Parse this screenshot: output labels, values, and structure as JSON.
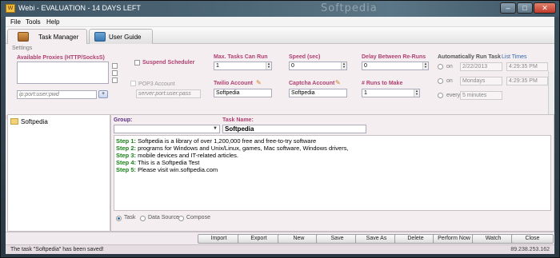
{
  "window": {
    "title": "Webi - EVALUATION - 14 DAYS LEFT",
    "watermark": "Softpedia",
    "app_icon": "app-icon",
    "controls": {
      "minimize": "–",
      "maximize": "□",
      "close": "✕"
    }
  },
  "menu": [
    "File",
    "Tools",
    "Help"
  ],
  "tabs": [
    {
      "label": "Task Manager",
      "icon": "briefcase-icon",
      "active": true
    },
    {
      "label": "User Guide",
      "icon": "guide-icon",
      "active": false
    }
  ],
  "settings": {
    "section_label": "Settings",
    "proxies": {
      "label": "Available Proxies (HTTP/SocksS)",
      "input_placeholder": "ip:port:user:pwd",
      "add_button": "+"
    },
    "suspend_scheduler": {
      "label": "Suspend Scheduler",
      "checked": false
    },
    "pop3": {
      "label": "POP3 Account",
      "placeholder": "server:port:user:pass"
    },
    "max_tasks": {
      "label": "Max. Tasks Can Run",
      "value": "1"
    },
    "twilio": {
      "label": "Twilio Account",
      "value": "Softpedia"
    },
    "speed": {
      "label": "Speed (sec)",
      "value": "0"
    },
    "captcha": {
      "label": "Captcha Account",
      "value": "Softpedia"
    },
    "delay": {
      "label": "Delay Between Re-Runs",
      "value": "0"
    },
    "runs_to_make": {
      "label": "# Runs to Make",
      "value": "1"
    },
    "auto_run": {
      "label": "Automatically Run Task",
      "list_times": "List Times",
      "options": [
        {
          "label": "on",
          "date": "2/22/2013",
          "time": "4:29:35 PM",
          "selected": false
        },
        {
          "label": "on",
          "date": "Mondays",
          "time": "4:29:35 PM",
          "selected": false
        },
        {
          "label": "every",
          "date": "5 minutes",
          "time": "",
          "selected": false
        }
      ]
    }
  },
  "tree": {
    "items": [
      "Softpedia"
    ]
  },
  "task": {
    "group_label": "Group:",
    "group_value": "",
    "name_label": "Task Name:",
    "name_value": "Softpedia",
    "steps": [
      {
        "n": "Step 1:",
        "text": "Softpedia is a library of over 1,200,000 free and free-to-try software"
      },
      {
        "n": "Step 2:",
        "text": "programs for Windows and Unix/Linux, games, Mac software, Windows drivers,"
      },
      {
        "n": "Step 3:",
        "text": "mobile devices and IT-related articles."
      },
      {
        "n": "Step 4:",
        "text": "This is a Softpedia Test"
      },
      {
        "n": "Step 5:",
        "text": "Please visit win.softpedia.com"
      }
    ],
    "modes": [
      {
        "label": "Task",
        "selected": true
      },
      {
        "label": "Data Source",
        "selected": false
      },
      {
        "label": "Compose",
        "selected": false
      }
    ]
  },
  "buttons": [
    "Import",
    "Export",
    "New",
    "Save",
    "Save As",
    "Delete",
    "Perform Now",
    "Watch",
    "Close"
  ],
  "status": {
    "message": "The task \"Softpedia\" has been saved!",
    "ip": "89.238.253.162"
  }
}
